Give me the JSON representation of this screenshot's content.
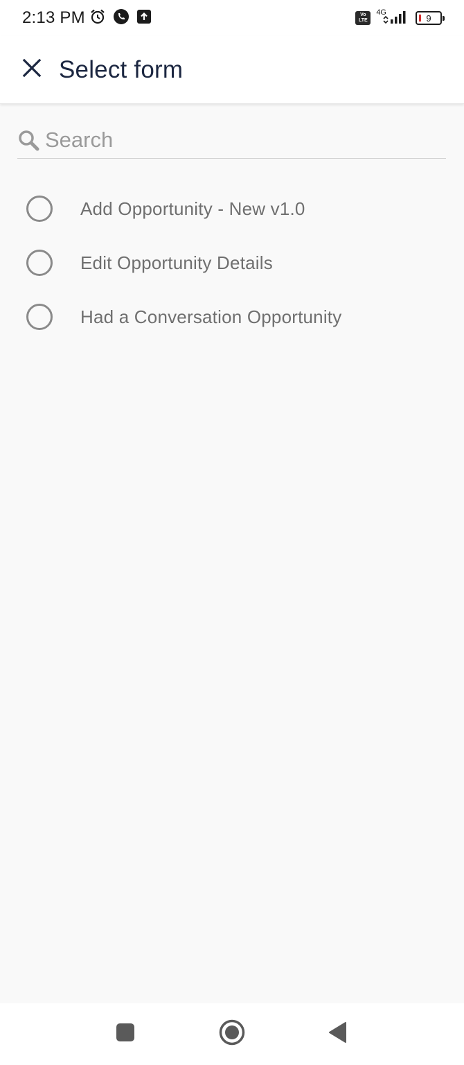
{
  "status_bar": {
    "time": "2:13 PM",
    "icons": [
      "alarm-icon",
      "phone-call-icon",
      "upload-icon"
    ],
    "volte": "Vo LTE",
    "network_type": "4G",
    "battery_level": "9",
    "battery_color": "#d32f2f"
  },
  "header": {
    "title": "Select form",
    "close_icon": "close-icon"
  },
  "search": {
    "placeholder": "Search",
    "value": ""
  },
  "forms": {
    "items": [
      {
        "label": "Add Opportunity - New v1.0",
        "selected": false
      },
      {
        "label": "Edit Opportunity Details",
        "selected": false
      },
      {
        "label": "Had a Conversation Opportunity",
        "selected": false
      }
    ]
  },
  "nav_bar": {
    "buttons": [
      "recents-icon",
      "home-icon",
      "back-icon"
    ]
  },
  "colors": {
    "title": "#1c2741",
    "label": "#6f6f6f",
    "background": "#f9f9f9"
  }
}
